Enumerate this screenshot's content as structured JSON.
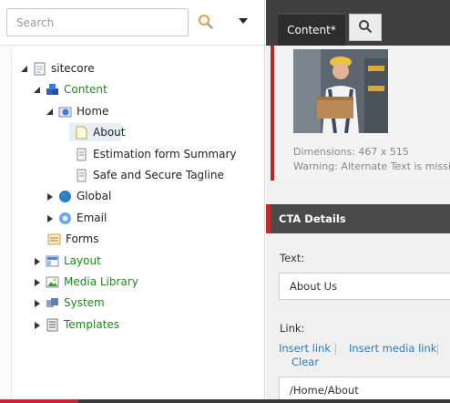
{
  "search": {
    "placeholder": "Search"
  },
  "tree": {
    "root": "sitecore",
    "content": "Content",
    "home": "Home",
    "about": "About",
    "estimation": "Estimation form Summary",
    "safe": "Safe and Secure Tagline",
    "global": "Global",
    "email": "Email",
    "forms": "Forms",
    "layout": "Layout",
    "media": "Media Library",
    "system": "System",
    "templates": "Templates"
  },
  "tabs": {
    "content": "Content*"
  },
  "image": {
    "dimensions": "Dimensions: 467 x 515",
    "warning": "Warning: Alternate Text is missing."
  },
  "cta": {
    "header": "CTA Details",
    "text_label": "Text:",
    "text_value": "About Us",
    "link_label": "Link:",
    "insert_link": "Insert link",
    "insert_media_link": "Insert media link",
    "clear": "Clear",
    "link_value": "/Home/About"
  },
  "colors": {
    "green": "#1a8a1a",
    "accent_red": "#c02a2a",
    "link_blue": "#2b7bb9",
    "tab_dark": "#3f3f3f"
  }
}
